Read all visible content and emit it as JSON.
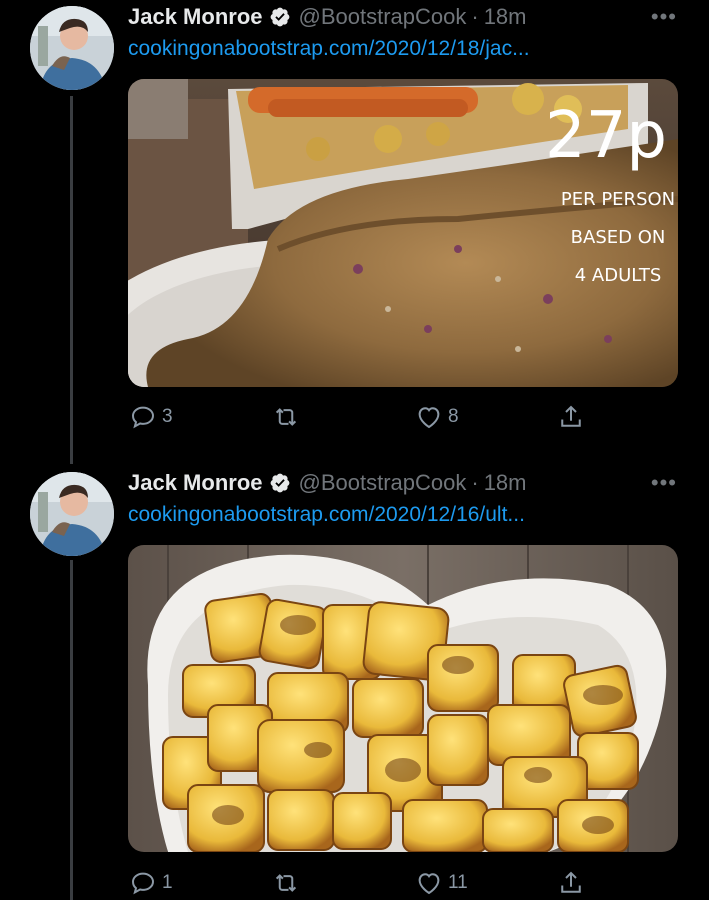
{
  "tweets": [
    {
      "author": "Jack Monroe",
      "handle": "@BootstrapCook",
      "separator": "·",
      "time": "18m",
      "more": "•••",
      "link": "cookingonabootstrap.com/2020/12/18/jac...",
      "image_overlay": {
        "price": "27p",
        "line1": "PER PERSON",
        "line2": "BASED ON",
        "line3": "4 ADULTS"
      },
      "replies": "3",
      "retweets": "",
      "likes": "8"
    },
    {
      "author": "Jack Monroe",
      "handle": "@BootstrapCook",
      "separator": "·",
      "time": "18m",
      "more": "•••",
      "link": "cookingonabootstrap.com/2020/12/16/ult...",
      "replies": "1",
      "retweets": "",
      "likes": "11"
    }
  ],
  "colors": {
    "background": "#000000",
    "link": "#1d9bf0",
    "muted": "#71767b",
    "thread_line": "#3a3d41"
  },
  "icons": [
    "verified-badge-icon",
    "reply-icon",
    "retweet-icon",
    "like-icon",
    "share-icon",
    "more-icon"
  ]
}
